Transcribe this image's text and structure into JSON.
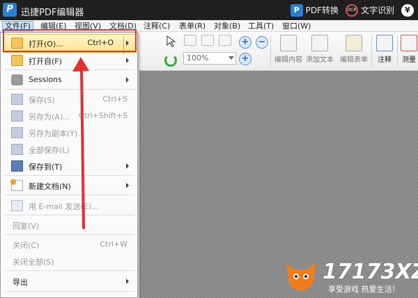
{
  "titlebar": {
    "app_title": "迅捷PDF编辑器",
    "pdf_convert": "PDF转换",
    "ocr_label": "文字识别",
    "ocr_icon_text": "OCR",
    "yen": "¥"
  },
  "menubar": {
    "items": [
      "文件(F)",
      "编辑(E)",
      "视图(V)",
      "文档(D)",
      "注释(C)",
      "表单(R)",
      "对象(B)",
      "工具(T)",
      "窗口(W)"
    ]
  },
  "toolbar": {
    "zoom_value": "100%",
    "edit_content": "编辑内容",
    "add_text": "添加文本",
    "edit_form": "编辑表单",
    "annotate": "注释",
    "measure": "测量"
  },
  "file_menu": {
    "items": [
      {
        "label": "打开(O)...",
        "shortcut": "Ctrl+O",
        "submenu": true,
        "enabled": true,
        "icon": "folder-icon"
      },
      {
        "label": "打开自(F)",
        "shortcut": "",
        "submenu": true,
        "enabled": true,
        "icon": "folder-web-icon"
      },
      {
        "label": "Sessions",
        "shortcut": "",
        "submenu": true,
        "enabled": true,
        "icon": "sessions-icon"
      },
      {
        "label": "保存(S)",
        "shortcut": "Ctrl+S",
        "submenu": false,
        "enabled": false,
        "icon": "save-icon"
      },
      {
        "label": "另存为(A)...",
        "shortcut": "Ctrl+Shift+S",
        "submenu": false,
        "enabled": false,
        "icon": "save-as-icon"
      },
      {
        "label": "另存为副本(Y)...",
        "shortcut": "",
        "submenu": false,
        "enabled": false,
        "icon": "save-copy-icon"
      },
      {
        "label": "全部保存(L)",
        "shortcut": "",
        "submenu": false,
        "enabled": false,
        "icon": "save-all-icon"
      },
      {
        "label": "保存到(T)",
        "shortcut": "",
        "submenu": true,
        "enabled": true,
        "icon": "save-to-icon"
      },
      {
        "label": "新建文档(N)",
        "shortcut": "",
        "submenu": true,
        "enabled": true,
        "icon": "new-document-icon"
      },
      {
        "label": "用 E-mail 发送(E)...",
        "shortcut": "",
        "submenu": false,
        "enabled": false,
        "icon": "email-icon"
      },
      {
        "label": "回复(V)",
        "shortcut": "",
        "submenu": false,
        "enabled": false,
        "icon": ""
      },
      {
        "label": "关闭(C)",
        "shortcut": "Ctrl+W",
        "submenu": false,
        "enabled": false,
        "icon": ""
      },
      {
        "label": "关闭全部(S)",
        "shortcut": "",
        "submenu": false,
        "enabled": false,
        "icon": ""
      },
      {
        "label": "导出",
        "shortcut": "",
        "submenu": true,
        "enabled": true,
        "icon": ""
      }
    ]
  },
  "watermark": {
    "brand": "17173XZ",
    "slogan": "享受游戏 热爱生活！"
  },
  "colors": {
    "highlight": "#ffe28a",
    "annotation_red": "#e03030",
    "titlebar": "#1f1f1f"
  }
}
